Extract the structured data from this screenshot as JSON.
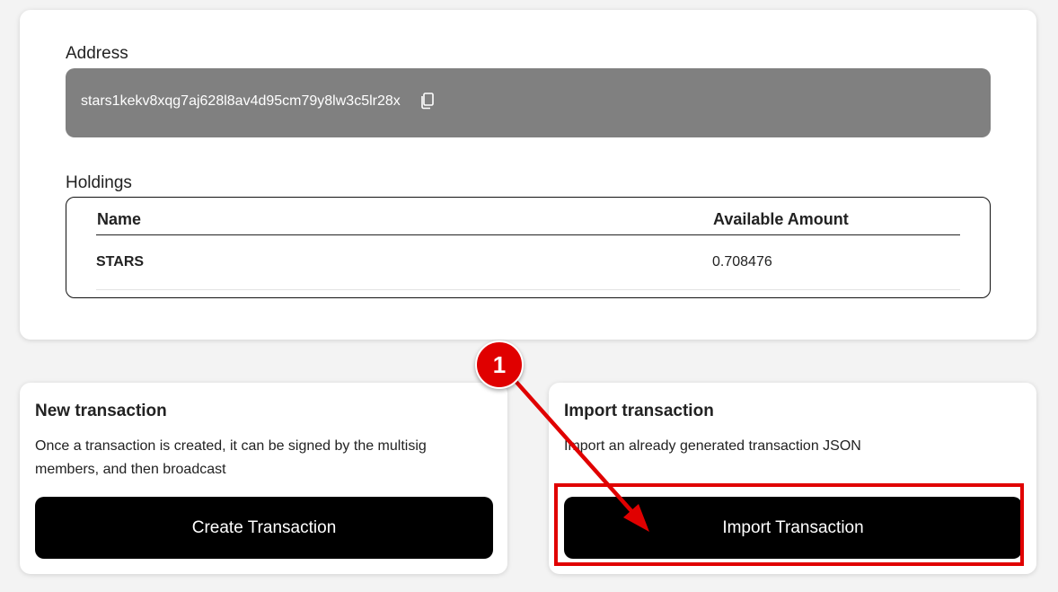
{
  "account": {
    "address_label": "Address",
    "address_value": "stars1kekv8xqg7aj628l8av4d95cm79y8lw3c5lr28x",
    "copy_icon": "copy-icon"
  },
  "holdings": {
    "label": "Holdings",
    "columns": [
      "Name",
      "Available Amount"
    ],
    "rows": [
      {
        "name": "STARS",
        "amount": "0.708476"
      }
    ]
  },
  "new_transaction": {
    "title": "New transaction",
    "description": "Once a transaction is created, it can be signed by the multisig members, and then broadcast",
    "button_label": "Create Transaction"
  },
  "import_transaction": {
    "title": "Import transaction",
    "description": "Import an already generated transaction JSON",
    "button_label": "Import Transaction"
  },
  "annotation": {
    "step_number": "1",
    "color": "#e00000"
  }
}
